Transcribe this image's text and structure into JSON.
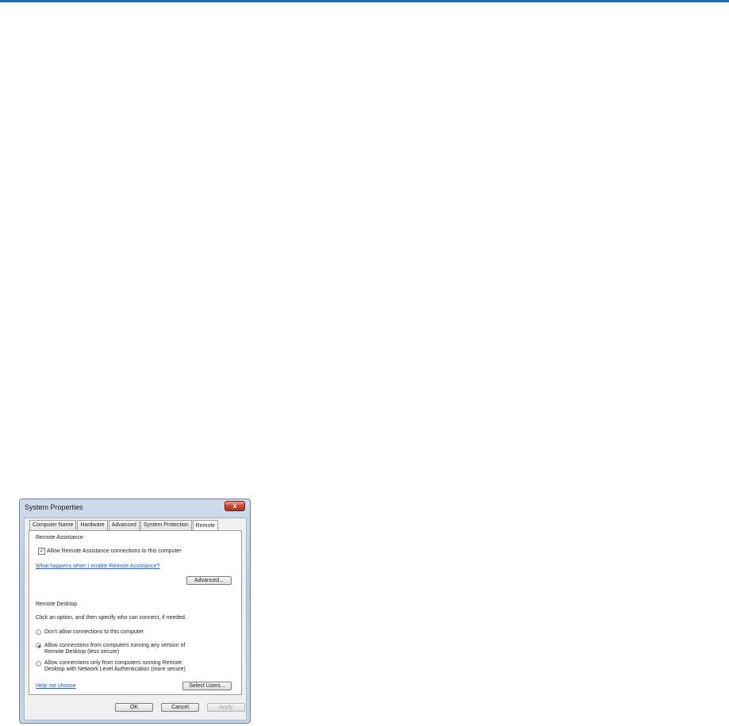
{
  "window": {
    "title": "System Properties",
    "close_glyph": "x"
  },
  "tabs": [
    {
      "label": "Computer Name"
    },
    {
      "label": "Hardware"
    },
    {
      "label": "Advanced"
    },
    {
      "label": "System Protection"
    },
    {
      "label": "Remote",
      "active": true
    }
  ],
  "remote_assistance": {
    "heading": "Remote Assistance",
    "allow_label": "Allow Remote Assistance connections to this computer",
    "allow_checked": true,
    "check_glyph": "✓",
    "help_link": "What happens when I enable Remote Assistance?",
    "advanced_button": "Advanced..."
  },
  "remote_desktop": {
    "heading": "Remote Desktop",
    "instructions": "Click an option, and then specify who can connect, if needed.",
    "options": [
      {
        "line1": "Don't allow connections to this computer",
        "line2": "",
        "selected": false
      },
      {
        "line1": "Allow connections from computers running any version of",
        "line2": "Remote Desktop (less secure)",
        "selected": true
      },
      {
        "line1": "Allow connections only from computers running Remote",
        "line2": "Desktop with Network Level Authentication (more secure)",
        "selected": false
      }
    ],
    "help_link": "Help me choose",
    "select_users_button": "Select Users..."
  },
  "footer": {
    "ok_button": "OK",
    "cancel_button": "Cancel",
    "apply_button": "Apply"
  },
  "colors": {
    "accent_rule": "#1f6fb5",
    "link": "#1f5fbf"
  }
}
